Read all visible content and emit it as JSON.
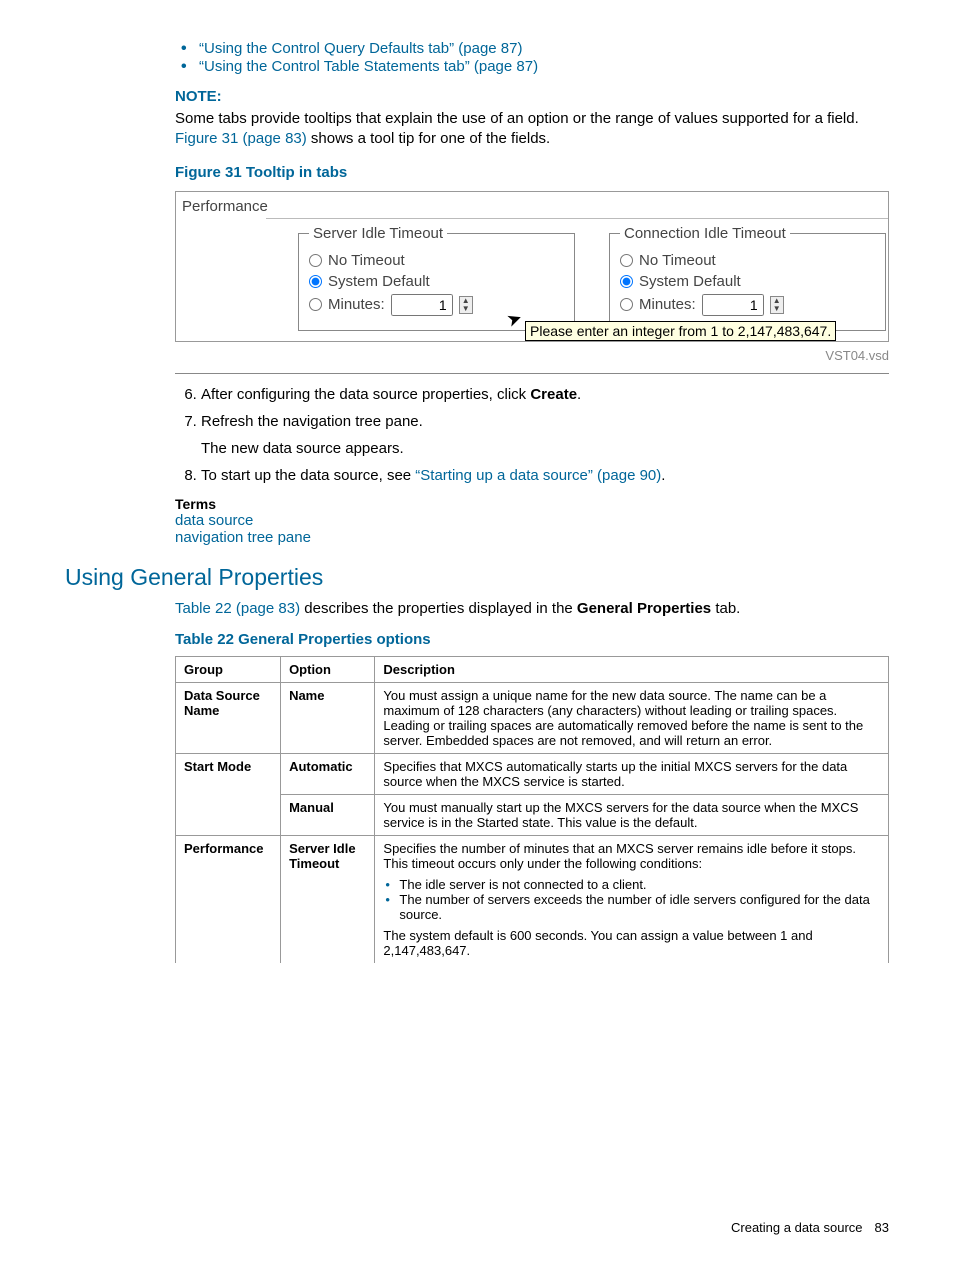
{
  "top_links": [
    "“Using the Control Query Defaults tab” (page 87)",
    "“Using the Control Table Statements tab” (page 87)"
  ],
  "note": {
    "heading": "NOTE:",
    "text_pre": "Some tabs provide tooltips that explain the use of an option or the range of values supported for a field. ",
    "link": "Figure 31 (page 83)",
    "text_post": " shows a tool tip for one of the fields."
  },
  "figure": {
    "title": "Figure 31 Tooltip in tabs",
    "group_label": "Performance",
    "server_legend": "Server Idle Timeout",
    "conn_legend": "Connection Idle Timeout",
    "opt_no_timeout": "No Timeout",
    "opt_system_default": "System Default",
    "opt_minutes": "Minutes:",
    "minutes_value": "1",
    "tooltip_text": "Please enter an integer from 1 to 2,147,483,647.",
    "vst_label": "VST04.vsd"
  },
  "steps": {
    "s6_pre": "After configuring the data source properties, click ",
    "s6_bold": "Create",
    "s6_post": ".",
    "s7a": "Refresh the navigation tree pane.",
    "s7b": "The new data source appears.",
    "s8_pre": "To start up the data source, see ",
    "s8_link": "“Starting up a data source” (page 90)",
    "s8_post": "."
  },
  "terms": {
    "heading": "Terms",
    "t1": "data source",
    "t2": "navigation tree pane"
  },
  "h2": "Using General Properties",
  "intro": {
    "link": "Table 22 (page 83)",
    "mid": " describes the properties displayed in the ",
    "bold": "General Properties",
    "post": " tab."
  },
  "table": {
    "title": "Table 22 General Properties options",
    "headers": [
      "Group",
      "Option",
      "Description"
    ],
    "rows": [
      {
        "group": "Data Source Name",
        "option": "Name",
        "desc": "You must assign a unique name for the new data source. The name can be a maximum of 128 characters (any characters) without leading or trailing spaces. Leading or trailing spaces are automatically removed before the name is sent to the server. Embedded spaces are not removed, and will return an error."
      },
      {
        "group": "Start Mode",
        "option": "Automatic",
        "desc": "Specifies that MXCS automatically starts up the initial MXCS servers for the data source when the MXCS service is started."
      },
      {
        "group": "",
        "option": "Manual",
        "desc": "You must manually start up the MXCS servers for the data source when the MXCS service is in the Started state. This value is the default."
      },
      {
        "group": "Performance",
        "option": "Server Idle Timeout",
        "desc_p1": "Specifies the number of minutes that an MXCS server remains idle before it stops. This timeout occurs only under the following conditions:",
        "bullets": [
          "The idle server is not connected to a client.",
          "The number of servers exceeds the number of idle servers configured for the data source."
        ],
        "desc_p2": "The system default is 600 seconds. You can assign a value between 1 and 2,147,483,647."
      }
    ]
  },
  "footer": {
    "label": "Creating a data source",
    "page": "83"
  }
}
